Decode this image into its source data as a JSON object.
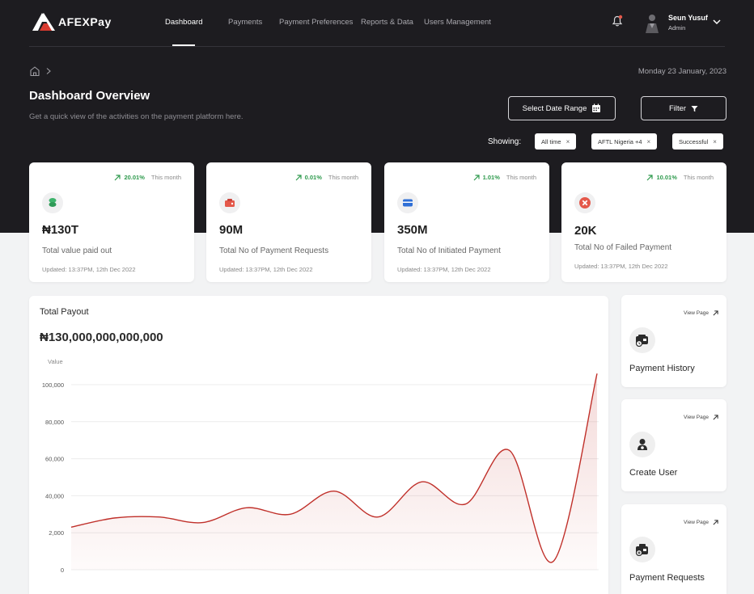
{
  "app": {
    "name": "AFEXPay"
  },
  "nav": {
    "items": [
      {
        "label": "Dashboard",
        "active": true
      },
      {
        "label": "Payments",
        "active": false
      },
      {
        "label": "Payment Preferences",
        "active": false
      },
      {
        "label": "Reports & Data",
        "active": false
      },
      {
        "label": "Users Management",
        "active": false
      }
    ]
  },
  "user": {
    "name": "Seun Yusuf",
    "role": "Admin"
  },
  "header": {
    "date": "Monday 23 January, 2023",
    "title": "Dashboard Overview",
    "subtitle": "Get a quick view of the activities on the payment platform here.",
    "date_range_label": "Select Date Range",
    "filter_label": "Filter",
    "showing_label": "Showing:",
    "chips": [
      "All time",
      "AFTL Nigeria +4",
      "Successful"
    ]
  },
  "stats": [
    {
      "trend": "20.01%",
      "period": "This month",
      "value": "₦130T",
      "label": "Total value paid out",
      "updated": "Updated: 13:37PM, 12th Dec 2022",
      "icon": "coins-icon",
      "color": "#3db36b"
    },
    {
      "trend": "0.01%",
      "period": "This month",
      "value": "90M",
      "label": "Total No of Payment Requests",
      "updated": "Updated: 13:37PM, 12th Dec 2022",
      "icon": "wallet-icon",
      "color": "#e4584a"
    },
    {
      "trend": "1.01%",
      "period": "This month",
      "value": "350M",
      "label": "Total No of Initiated Payment",
      "updated": "Updated: 13:37PM, 12th Dec 2022",
      "icon": "card-icon",
      "color": "#2f6fd6"
    },
    {
      "trend": "10.01%",
      "period": "This month",
      "value": "20K",
      "label": "Total No of Failed Payment",
      "updated": "Updated: 13:37PM, 12th Dec 2022",
      "icon": "close-circle-icon",
      "color": "#e4584a"
    }
  ],
  "chart": {
    "title": "Total Payout",
    "total": "₦130,000,000,000,000",
    "ylabel": "Value"
  },
  "chart_data": {
    "type": "area",
    "title": "Total Payout",
    "ylabel": "Value",
    "y_tick_labels": [
      "100,000",
      "80,000",
      "60,000",
      "40,000",
      "2,000",
      "0"
    ],
    "y_tick_values": [
      100000,
      80000,
      60000,
      40000,
      20000,
      0
    ],
    "ylim": [
      0,
      100000
    ],
    "grid": true,
    "legend": "none",
    "color": "#c0302a",
    "values": [
      23000,
      28000,
      28500,
      25500,
      33500,
      30000,
      42500,
      28500,
      47500,
      35500,
      64500,
      4500,
      106000
    ]
  },
  "quick_links": [
    {
      "label": "Payment History",
      "view": "View Page",
      "icon": "payment-history-icon"
    },
    {
      "label": "Create User",
      "view": "View Page",
      "icon": "create-user-icon"
    },
    {
      "label": "Payment Requests",
      "view": "View Page",
      "icon": "payment-requests-icon"
    }
  ]
}
